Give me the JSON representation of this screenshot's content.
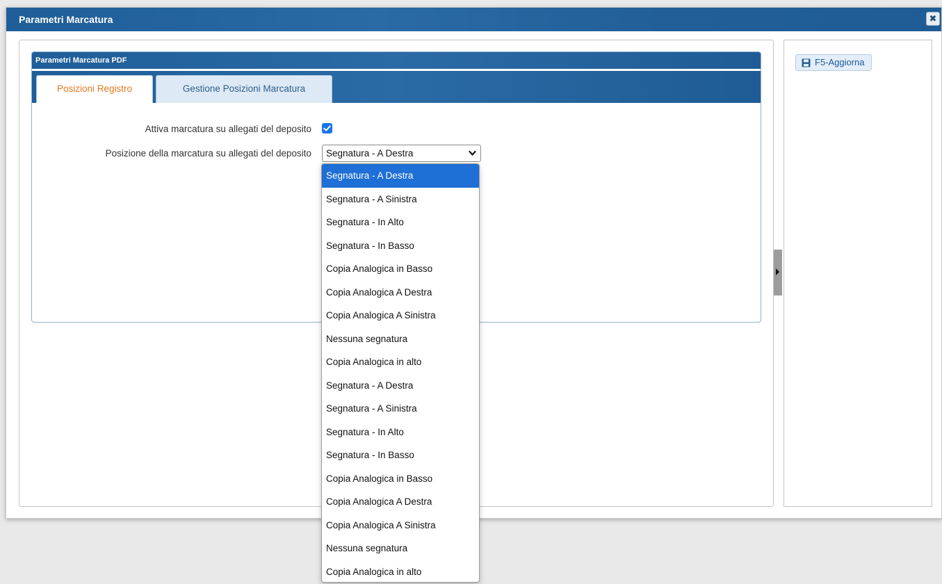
{
  "window": {
    "title": "Parametri Marcatura",
    "close_icon": "close-icon"
  },
  "fieldset": {
    "title": "Parametri Marcatura PDF"
  },
  "tabs": [
    {
      "label": "Posizioni Registro",
      "active": true
    },
    {
      "label": "Gestione Posizioni Marcatura",
      "active": false
    }
  ],
  "form": {
    "activate_label": "Attiva marcatura su allegati del deposito",
    "activate_checked": true,
    "position_label": "Posizione della marcatura su allegati del deposito",
    "position_value": "Segnatura - A Destra"
  },
  "dropdown": {
    "selected_index": 0,
    "options": [
      "Segnatura - A Destra",
      "Segnatura - A Sinistra",
      "Segnatura - In Alto",
      "Segnatura - In Basso",
      "Copia Analogica in Basso",
      "Copia Analogica A Destra",
      "Copia Analogica A Sinistra",
      "Nessuna segnatura",
      "Copia Analogica in alto",
      "Segnatura - A Destra",
      "Segnatura - A Sinistra",
      "Segnatura - In Alto",
      "Segnatura - In Basso",
      "Copia Analogica in Basso",
      "Copia Analogica A Destra",
      "Copia Analogica A Sinistra",
      "Nessuna segnatura",
      "Copia Analogica in alto"
    ]
  },
  "sidebar": {
    "refresh_label": "F5-Aggiorna",
    "refresh_icon": "save-icon"
  },
  "colors": {
    "header_blue": "#2a6aa5",
    "active_tab_text": "#e07a1f",
    "selected_option": "#1e6fd6"
  }
}
